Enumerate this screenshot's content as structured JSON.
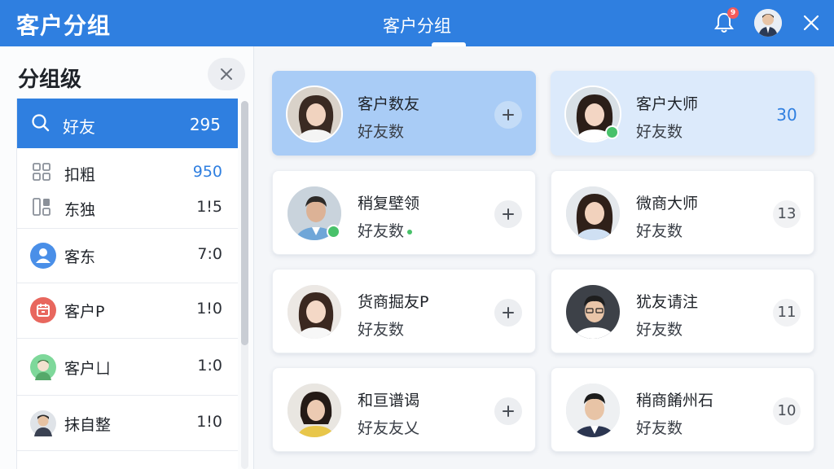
{
  "header": {
    "app_title": "客户分组",
    "center_title": "客户分组",
    "notification_count": "9"
  },
  "left_panel": {
    "title": "分组级",
    "items": [
      {
        "label": "好友",
        "count": "295",
        "icon": "search-icon"
      },
      {
        "label": "扣粗",
        "count": "950",
        "icon": "grid-icon"
      },
      {
        "label": "东独",
        "count": "1!5",
        "icon": "columns-icon"
      },
      {
        "label": "客东",
        "count": "7:0",
        "icon": "person-icon"
      },
      {
        "label": "客户P",
        "count": "1!0",
        "icon": "calendar-icon"
      },
      {
        "label": "客户ㄩ",
        "count": "1:0",
        "icon": "avatar-icon"
      },
      {
        "label": "抹自整",
        "count": "1!0",
        "icon": "avatar-icon"
      }
    ]
  },
  "cards": [
    {
      "name": "客户数友",
      "sub": "好友数",
      "action": "+",
      "online": false
    },
    {
      "name": "客户大师",
      "sub": "好友数",
      "action": "30",
      "online": true
    },
    {
      "name": "稍复壁领",
      "sub": "好友数",
      "action": "+",
      "online": true
    },
    {
      "name": "微商大师",
      "sub": "好友数",
      "action": "13",
      "online": false
    },
    {
      "name": "货商掘友P",
      "sub": "好友数",
      "action": "+",
      "online": false
    },
    {
      "name": "犹友请注",
      "sub": "好友数",
      "action": "11",
      "online": false
    },
    {
      "name": "和亘谱谒",
      "sub": "好友友乂",
      "action": "+",
      "online": false
    },
    {
      "name": "稍商餚州石",
      "sub": "好友数",
      "action": "10",
      "online": false
    }
  ],
  "colors": {
    "accent": "#2f7fe0",
    "online": "#48c16a",
    "badge": "#f25a5a"
  }
}
